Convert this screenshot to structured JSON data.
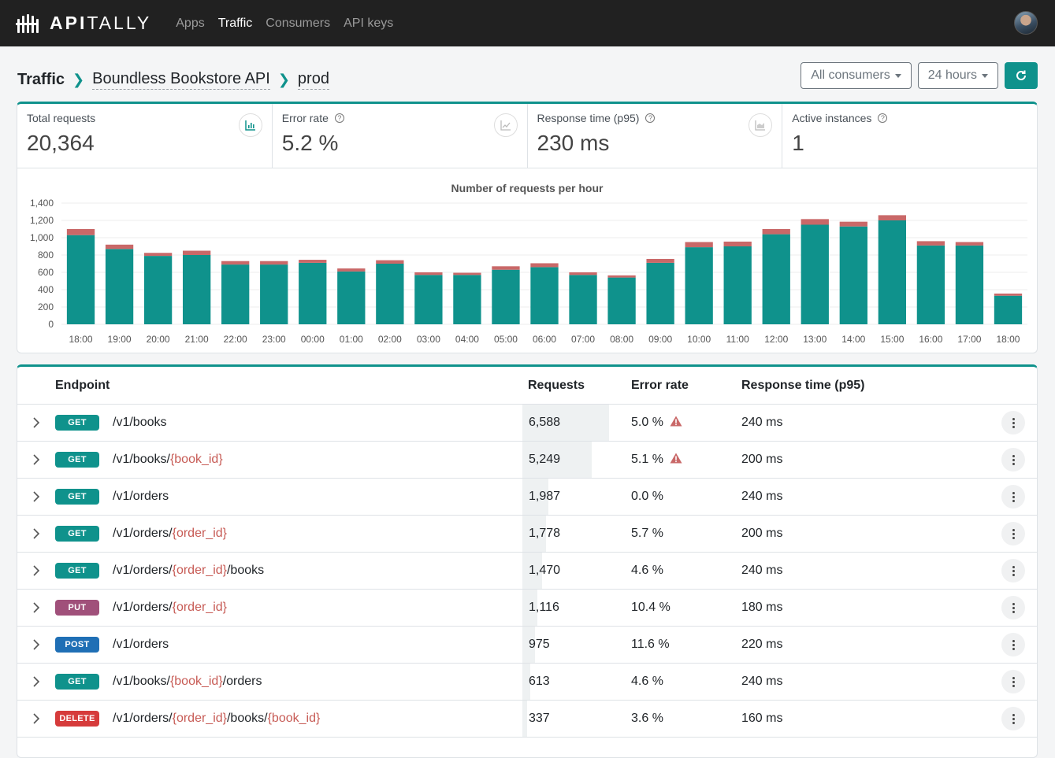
{
  "brand": {
    "name_bold": "API",
    "name_rest": "TALLY"
  },
  "nav": [
    {
      "label": "Apps",
      "active": false
    },
    {
      "label": "Traffic",
      "active": true
    },
    {
      "label": "Consumers",
      "active": false
    },
    {
      "label": "API keys",
      "active": false
    }
  ],
  "breadcrumb": {
    "root": "Traffic",
    "app": "Boundless Bookstore API",
    "env": "prod"
  },
  "controls": {
    "consumers": "All consumers",
    "period": "24 hours"
  },
  "metrics": [
    {
      "label": "Total requests",
      "value": "20,364",
      "icon": "bar-chart-icon"
    },
    {
      "label": "Error rate",
      "value": "5.2 %",
      "icon": "line-chart-icon"
    },
    {
      "label": "Response time (p95)",
      "value": "230 ms",
      "icon": "area-chart-icon"
    },
    {
      "label": "Active instances",
      "value": "1"
    }
  ],
  "colors": {
    "accent": "#0f928c",
    "error": "#c96868",
    "get": "#0f928c",
    "put": "#a0507a",
    "post": "#1f6fb5",
    "delete": "#d63b3b"
  },
  "chart_data": {
    "type": "bar",
    "title": "Number of requests per hour",
    "categories": [
      "18:00",
      "19:00",
      "20:00",
      "21:00",
      "22:00",
      "23:00",
      "00:00",
      "01:00",
      "02:00",
      "03:00",
      "04:00",
      "05:00",
      "06:00",
      "07:00",
      "08:00",
      "09:00",
      "10:00",
      "11:00",
      "12:00",
      "13:00",
      "14:00",
      "15:00",
      "16:00",
      "17:00",
      "18:00"
    ],
    "series": [
      {
        "name": "",
        "values": [
          1030,
          870,
          790,
          800,
          690,
          690,
          710,
          610,
          700,
          570,
          570,
          630,
          660,
          570,
          540,
          710,
          890,
          900,
          1040,
          1150,
          1130,
          1200,
          910,
          910,
          330
        ]
      },
      {
        "name": "",
        "values": [
          70,
          50,
          35,
          50,
          40,
          40,
          35,
          35,
          40,
          30,
          25,
          40,
          45,
          30,
          25,
          45,
          60,
          55,
          60,
          65,
          55,
          60,
          50,
          40,
          25
        ]
      }
    ],
    "yticks": [
      "0",
      "200",
      "400",
      "600",
      "800",
      "1,000",
      "1,200",
      "1,400"
    ],
    "ylim": [
      0,
      1400
    ],
    "grid": true
  },
  "table": {
    "headers": {
      "endpoint": "Endpoint",
      "requests": "Requests",
      "error_rate": "Error rate",
      "response_time": "Response time (p95)"
    },
    "rows": [
      {
        "method": "GET",
        "path": [
          "/v1/books"
        ],
        "requests": "6,588",
        "share": 1.0,
        "error_rate": "5.0 %",
        "warn": true,
        "rt": "240 ms"
      },
      {
        "method": "GET",
        "path": [
          "/v1/books/",
          "{book_id}"
        ],
        "requests": "5,249",
        "share": 0.797,
        "error_rate": "5.1 %",
        "warn": true,
        "rt": "200 ms"
      },
      {
        "method": "GET",
        "path": [
          "/v1/orders"
        ],
        "requests": "1,987",
        "share": 0.302,
        "error_rate": "0.0 %",
        "warn": false,
        "rt": "240 ms"
      },
      {
        "method": "GET",
        "path": [
          "/v1/orders/",
          "{order_id}"
        ],
        "requests": "1,778",
        "share": 0.27,
        "error_rate": "5.7 %",
        "warn": false,
        "rt": "200 ms"
      },
      {
        "method": "GET",
        "path": [
          "/v1/orders/",
          "{order_id}",
          "/books"
        ],
        "requests": "1,470",
        "share": 0.223,
        "error_rate": "4.6 %",
        "warn": false,
        "rt": "240 ms"
      },
      {
        "method": "PUT",
        "path": [
          "/v1/orders/",
          "{order_id}"
        ],
        "requests": "1,116",
        "share": 0.169,
        "error_rate": "10.4 %",
        "warn": false,
        "rt": "180 ms"
      },
      {
        "method": "POST",
        "path": [
          "/v1/orders"
        ],
        "requests": "975",
        "share": 0.148,
        "error_rate": "11.6 %",
        "warn": false,
        "rt": "220 ms"
      },
      {
        "method": "GET",
        "path": [
          "/v1/books/",
          "{book_id}",
          "/orders"
        ],
        "requests": "613",
        "share": 0.093,
        "error_rate": "4.6 %",
        "warn": false,
        "rt": "240 ms"
      },
      {
        "method": "DELETE",
        "path": [
          "/v1/orders/",
          "{order_id}",
          "/books/",
          "{book_id}"
        ],
        "requests": "337",
        "share": 0.051,
        "error_rate": "3.6 %",
        "warn": false,
        "rt": "160 ms"
      }
    ]
  }
}
